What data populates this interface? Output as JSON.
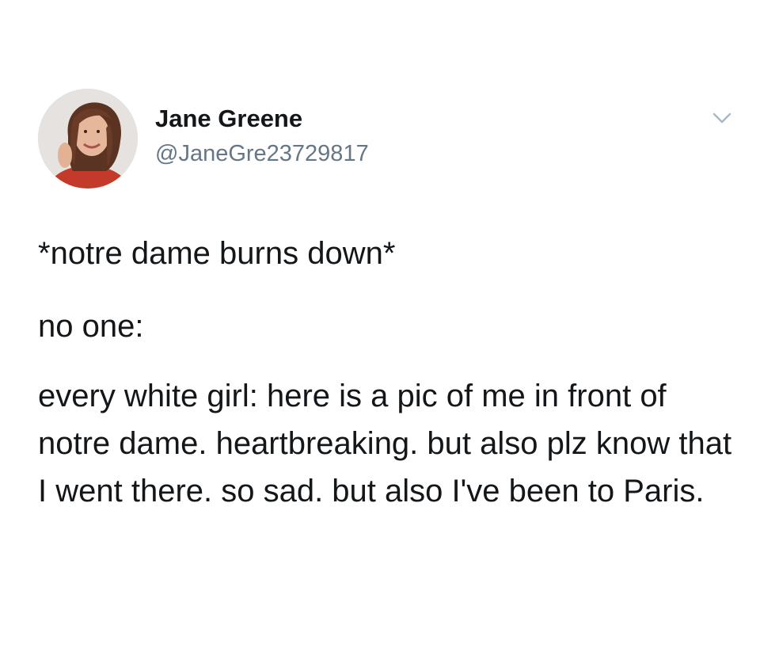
{
  "tweet": {
    "author": {
      "display_name": "Jane Greene",
      "handle": "@JaneGre23729817",
      "avatar_icon": "profile-photo"
    },
    "menu_icon": "chevron-down-icon",
    "paragraphs": [
      "*notre dame burns down*",
      "no one:",
      "every white girl: here is a pic of me in front of notre dame. heartbreaking. but also plz know that I went there. so sad. but also I've been to Paris."
    ]
  },
  "colors": {
    "text_primary": "#14171a",
    "text_secondary": "#657786",
    "caret": "#aab8c2",
    "background": "#ffffff"
  }
}
